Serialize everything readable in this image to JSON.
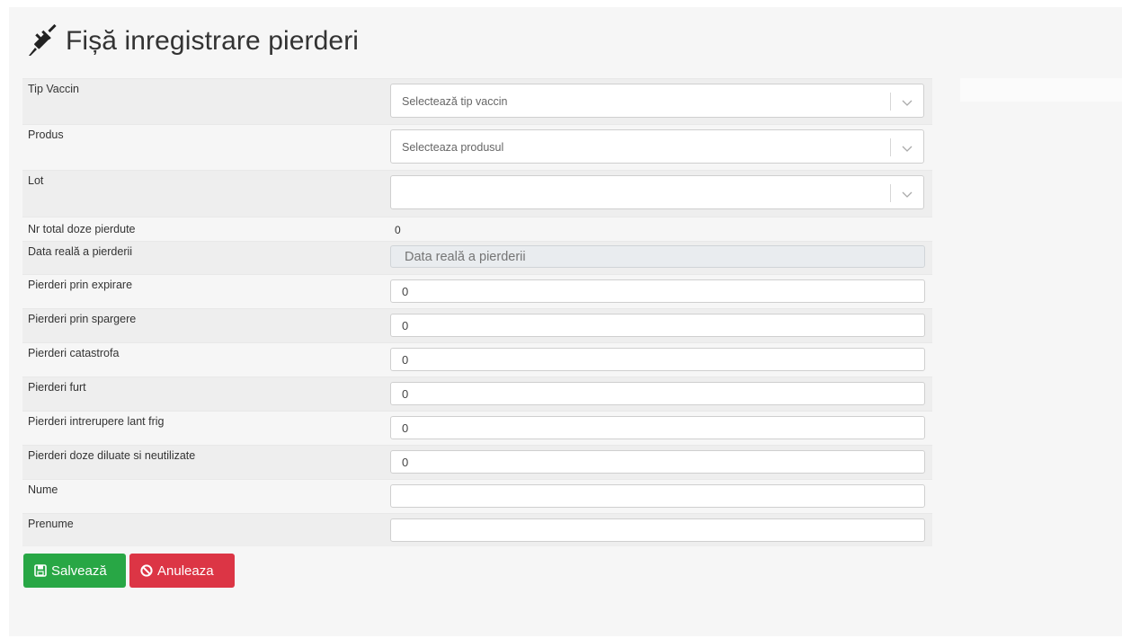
{
  "page": {
    "title": "Fișă inregistrare pierderi",
    "title_icon": "syringe-icon"
  },
  "form": {
    "tip_vaccin": {
      "label": "Tip Vaccin",
      "placeholder": "Selectează tip vaccin"
    },
    "produs": {
      "label": "Produs",
      "placeholder": "Selecteaza produsul"
    },
    "lot": {
      "label": "Lot",
      "placeholder": ""
    },
    "nr_total": {
      "label": "Nr total doze pierdute",
      "value": "0"
    },
    "data_reala": {
      "label": "Data reală a pierderii",
      "placeholder": "Data reală a pierderii"
    },
    "expirare": {
      "label": "Pierderi prin expirare",
      "value": "0"
    },
    "spargere": {
      "label": "Pierderi prin spargere",
      "value": "0"
    },
    "catastrofa": {
      "label": "Pierderi catastrofa",
      "value": "0"
    },
    "furt": {
      "label": "Pierderi furt",
      "value": "0"
    },
    "lant_frig": {
      "label": "Pierderi intrerupere lant frig",
      "value": "0"
    },
    "diluate": {
      "label": "Pierderi doze diluate si neutilizate",
      "value": "0"
    },
    "nume": {
      "label": "Nume",
      "value": ""
    },
    "prenume": {
      "label": "Prenume",
      "value": ""
    }
  },
  "buttons": {
    "save": {
      "label": "Salvează",
      "icon": "save-icon",
      "color": "#28a745"
    },
    "cancel": {
      "label": "Anuleaza",
      "icon": "ban-icon",
      "color": "#dc3545"
    }
  }
}
